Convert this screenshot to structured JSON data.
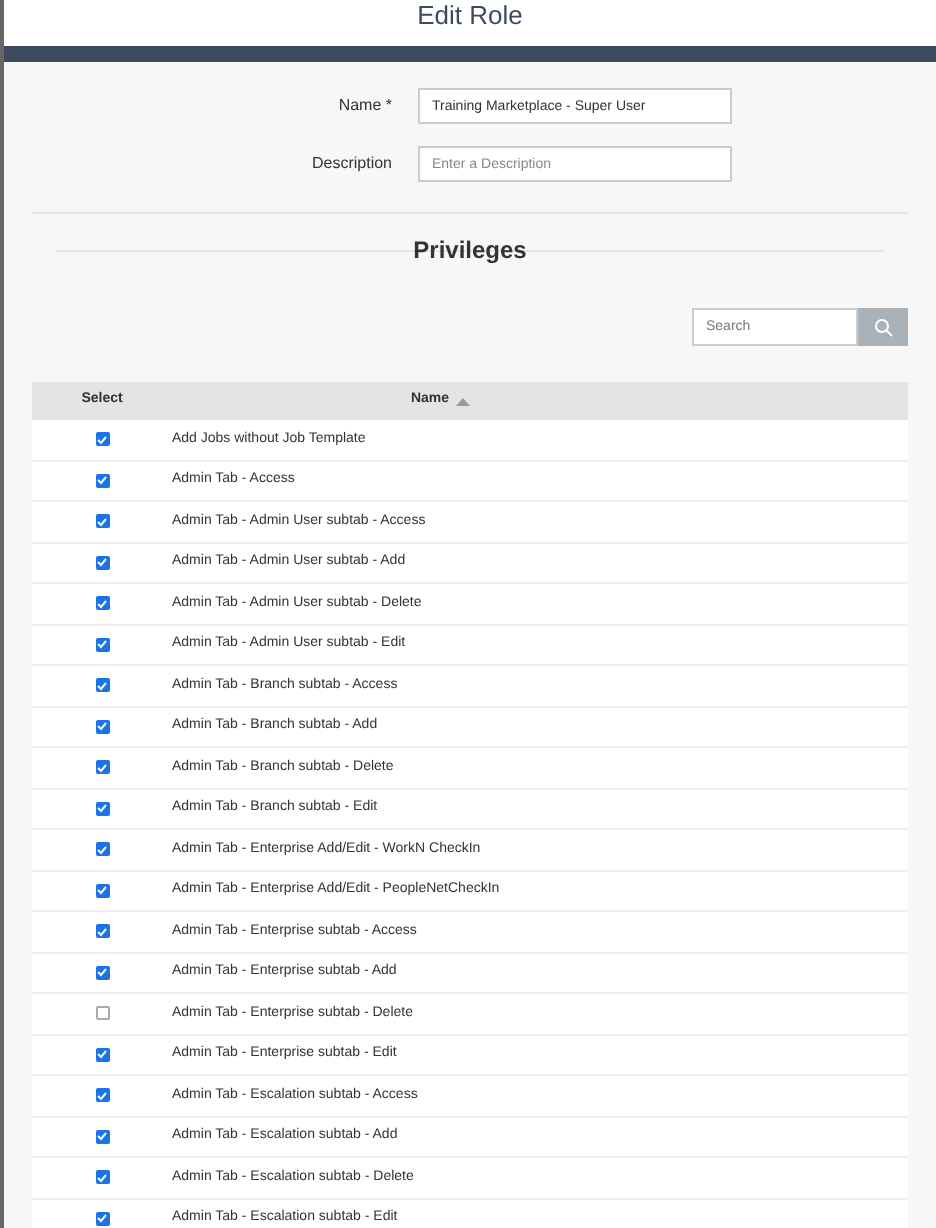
{
  "title": "Edit Role",
  "form": [
    {
      "label": "Name *",
      "value": "Training Marketplace - Super User"
    },
    {
      "label": "Description",
      "placeholder": "Enter a Description"
    }
  ],
  "section_title": "Privileges",
  "search": {
    "placeholder": "Search"
  },
  "table": {
    "columns": [
      "Select",
      "Name"
    ],
    "rows": [
      {
        "checked": true,
        "name": "Add Jobs without Job Template"
      },
      {
        "checked": true,
        "name": "Admin Tab - Access"
      },
      {
        "checked": true,
        "name": "Admin Tab - Admin User subtab - Access"
      },
      {
        "checked": true,
        "name": "Admin Tab - Admin User subtab - Add"
      },
      {
        "checked": true,
        "name": "Admin Tab - Admin User subtab - Delete"
      },
      {
        "checked": true,
        "name": "Admin Tab - Admin User subtab - Edit"
      },
      {
        "checked": true,
        "name": "Admin Tab - Branch subtab - Access"
      },
      {
        "checked": true,
        "name": "Admin Tab - Branch subtab - Add"
      },
      {
        "checked": true,
        "name": "Admin Tab - Branch subtab - Delete"
      },
      {
        "checked": true,
        "name": "Admin Tab - Branch subtab - Edit"
      },
      {
        "checked": true,
        "name": "Admin Tab - Enterprise Add/Edit - WorkN CheckIn"
      },
      {
        "checked": true,
        "name": "Admin Tab - Enterprise Add/Edit - PeopleNetCheckIn"
      },
      {
        "checked": true,
        "name": "Admin Tab - Enterprise subtab - Access"
      },
      {
        "checked": true,
        "name": "Admin Tab - Enterprise subtab - Add"
      },
      {
        "checked": false,
        "name": "Admin Tab - Enterprise subtab - Delete"
      },
      {
        "checked": true,
        "name": "Admin Tab - Enterprise subtab - Edit"
      },
      {
        "checked": true,
        "name": "Admin Tab - Escalation subtab - Access"
      },
      {
        "checked": true,
        "name": "Admin Tab - Escalation subtab - Add"
      },
      {
        "checked": true,
        "name": "Admin Tab - Escalation subtab - Delete"
      },
      {
        "checked": true,
        "name": "Admin Tab - Escalation subtab - Edit"
      }
    ]
  }
}
